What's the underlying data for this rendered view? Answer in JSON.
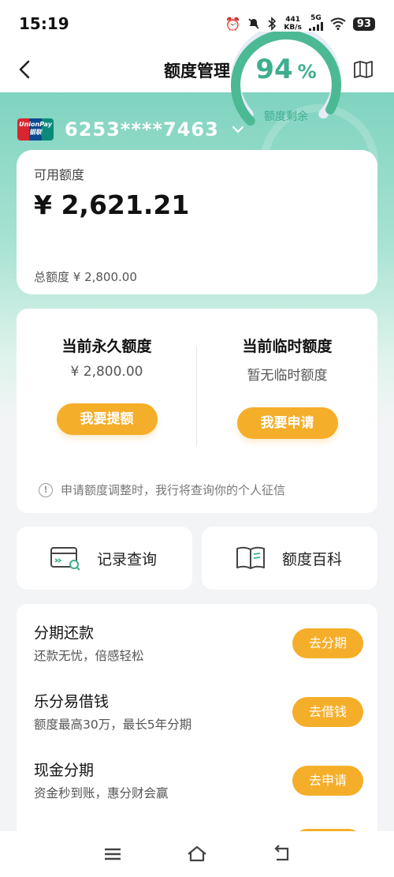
{
  "status_bar": {
    "time": "15:19",
    "net_speed_value": "441",
    "net_speed_unit": "KB/s",
    "network": "5G",
    "battery": "93",
    "icons": [
      "alarm-icon",
      "mute-icon",
      "bluetooth-icon",
      "signal-icon",
      "wifi-icon",
      "battery-icon"
    ]
  },
  "nav": {
    "title": "额度管理",
    "back_icon": "back-arrow-icon",
    "guide_icon": "book-icon"
  },
  "card": {
    "brand_text_1": "UnionPay",
    "brand_text_2": "银联",
    "number": "6253****7463",
    "chevron_icon": "chevron-down-icon"
  },
  "credit": {
    "available_label": "可用额度",
    "available_amount": "¥ 2,621.21",
    "total_text": "总额度 ¥ 2,800.00",
    "remaining_percent": 94,
    "remaining_percent_text": "94",
    "percent_sign": "%",
    "remaining_label": "额度剩余"
  },
  "quota": {
    "permanent_title": "当前永久额度",
    "permanent_value": "¥ 2,800.00",
    "permanent_button": "我要提额",
    "temporary_title": "当前临时额度",
    "temporary_value": "暂无临时额度",
    "temporary_button": "我要申请",
    "notice": "申请额度调整时，我行将查询你的个人征信",
    "notice_icon": "info-icon"
  },
  "shortcuts": [
    {
      "label": "记录查询",
      "icon": "record-search-icon"
    },
    {
      "label": "额度百科",
      "icon": "open-book-icon"
    }
  ],
  "services": [
    {
      "title": "分期还款",
      "desc": "还款无忧，倍感轻松",
      "button": "去分期"
    },
    {
      "title": "乐分易借钱",
      "desc": "额度最高30万，最长5年分期",
      "button": "去借钱"
    },
    {
      "title": "现金分期",
      "desc": "资金秒到账，惠分财会赢",
      "button": "去申请"
    }
  ],
  "bottom_nav": {
    "icons": [
      "menu-icon",
      "home-icon",
      "back-icon"
    ]
  },
  "colors": {
    "accent_green": "#3dae8e",
    "button_orange": "#f5ae2a",
    "header_gradient_top": "#7fd3bf"
  }
}
